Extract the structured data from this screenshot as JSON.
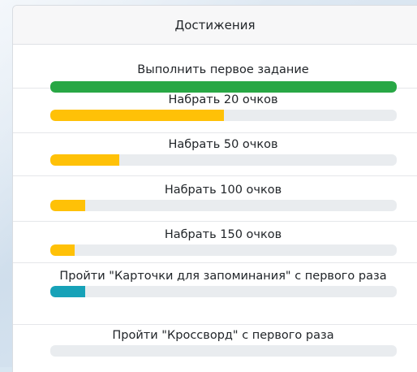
{
  "header": {
    "title": "Достижения"
  },
  "achievements": [
    {
      "title": "Выполнить первое задание",
      "progress": 1.0,
      "color": "#28a745"
    },
    {
      "title": "Набрать 20 очков",
      "progress": 0.5,
      "color": "#ffc107"
    },
    {
      "title": "Набрать 50 очков",
      "progress": 0.2,
      "color": "#ffc107"
    },
    {
      "title": "Набрать 100 очков",
      "progress": 0.1,
      "color": "#ffc107"
    },
    {
      "title": "Набрать 150 очков",
      "progress": 0.07,
      "color": "#ffc107"
    },
    {
      "title": "Пройти \"Карточки для запоминания\" с первого раза",
      "progress": 0.1,
      "color": "#17a2b8"
    },
    {
      "title": "Пройти \"Кроссворд\" с первого раза",
      "progress": 0.0,
      "color": "#17a2b8"
    }
  ]
}
